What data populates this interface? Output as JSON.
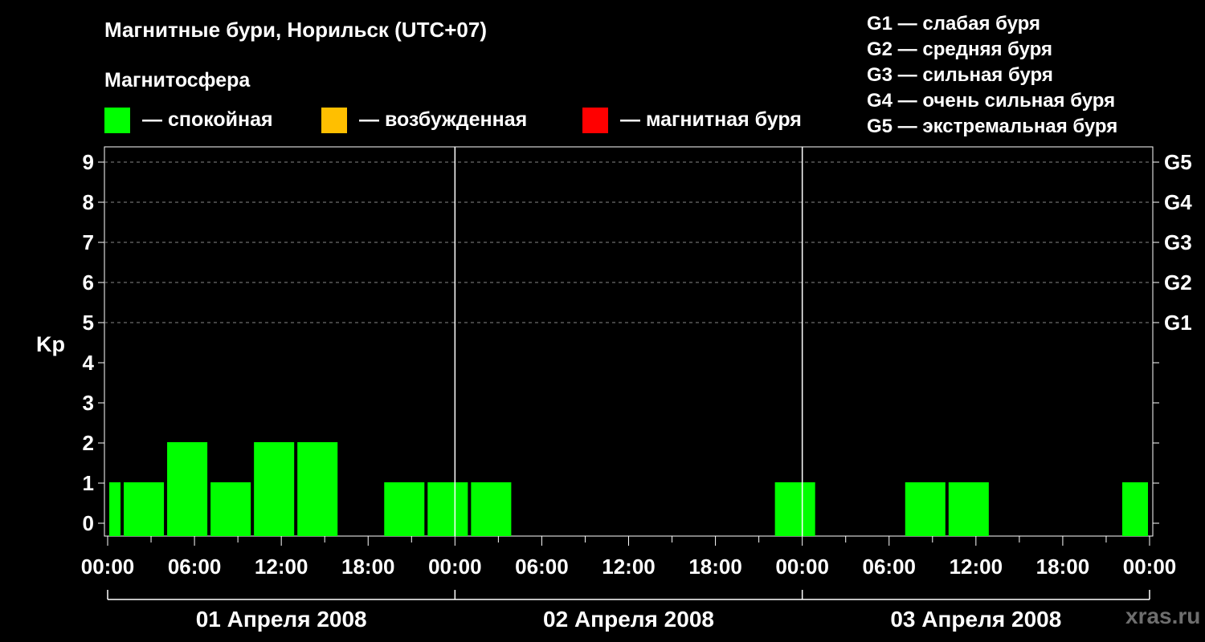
{
  "title": "Магнитные бури, Норильск (UTC+07)",
  "subtitle": "Магнитосфера",
  "legend": [
    {
      "label": "— спокойная",
      "color": "#00ff00"
    },
    {
      "label": "— возбужденная",
      "color": "#ffbf00"
    },
    {
      "label": "— магнитная буря",
      "color": "#ff0000"
    }
  ],
  "g_legend": [
    "G1 — слабая буря",
    "G2 — средняя буря",
    "G3 — сильная буря",
    "G4 — очень сильная буря",
    "G5 — экстремальная буря"
  ],
  "watermark": "xras.ru",
  "chart_data": {
    "type": "bar",
    "ylabel": "Kp",
    "ylim": [
      0,
      9
    ],
    "yticks": [
      "0",
      "1",
      "2",
      "3",
      "4",
      "5",
      "6",
      "7",
      "8",
      "9"
    ],
    "right_axis_labels": [
      {
        "kp": 5,
        "label": "G1"
      },
      {
        "kp": 6,
        "label": "G2"
      },
      {
        "kp": 7,
        "label": "G3"
      },
      {
        "kp": 8,
        "label": "G4"
      },
      {
        "kp": 9,
        "label": "G5"
      }
    ],
    "xtick_labels": [
      "00:00",
      "06:00",
      "12:00",
      "18:00",
      "00:00",
      "06:00",
      "12:00",
      "18:00",
      "00:00",
      "06:00",
      "12:00",
      "18:00",
      "00:00"
    ],
    "days": [
      "01 Апреля 2008",
      "02 Апреля 2008",
      "03 Апреля 2008"
    ],
    "grid": true,
    "color": "#00ff00",
    "bars": [
      {
        "start": "01.04 00:00",
        "end": "01.04 01:00",
        "kp": 1
      },
      {
        "start": "01.04 01:00",
        "end": "01.04 04:00",
        "kp": 1
      },
      {
        "start": "01.04 04:00",
        "end": "01.04 07:00",
        "kp": 2
      },
      {
        "start": "01.04 07:00",
        "end": "01.04 10:00",
        "kp": 1
      },
      {
        "start": "01.04 10:00",
        "end": "01.04 13:00",
        "kp": 2
      },
      {
        "start": "01.04 13:00",
        "end": "01.04 16:00",
        "kp": 2
      },
      {
        "start": "01.04 16:00",
        "end": "01.04 19:00",
        "kp": 0
      },
      {
        "start": "01.04 19:00",
        "end": "01.04 22:00",
        "kp": 1
      },
      {
        "start": "01.04 22:00",
        "end": "02.04 01:00",
        "kp": 1
      },
      {
        "start": "02.04 01:00",
        "end": "02.04 04:00",
        "kp": 1
      },
      {
        "start": "02.04 04:00",
        "end": "02.04 07:00",
        "kp": 0
      },
      {
        "start": "02.04 07:00",
        "end": "02.04 10:00",
        "kp": 0
      },
      {
        "start": "02.04 10:00",
        "end": "02.04 13:00",
        "kp": 0
      },
      {
        "start": "02.04 13:00",
        "end": "02.04 16:00",
        "kp": 0
      },
      {
        "start": "02.04 16:00",
        "end": "02.04 19:00",
        "kp": 0
      },
      {
        "start": "02.04 19:00",
        "end": "02.04 22:00",
        "kp": 0
      },
      {
        "start": "02.04 22:00",
        "end": "03.04 01:00",
        "kp": 1
      },
      {
        "start": "03.04 01:00",
        "end": "03.04 04:00",
        "kp": 0
      },
      {
        "start": "03.04 04:00",
        "end": "03.04 07:00",
        "kp": 0
      },
      {
        "start": "03.04 07:00",
        "end": "03.04 10:00",
        "kp": 1
      },
      {
        "start": "03.04 10:00",
        "end": "03.04 13:00",
        "kp": 1
      },
      {
        "start": "03.04 13:00",
        "end": "03.04 16:00",
        "kp": 0
      },
      {
        "start": "03.04 16:00",
        "end": "03.04 19:00",
        "kp": 0
      },
      {
        "start": "03.04 19:00",
        "end": "03.04 22:00",
        "kp": 0
      },
      {
        "start": "03.04 22:00",
        "end": "04.04 00:00",
        "kp": 1
      }
    ]
  }
}
